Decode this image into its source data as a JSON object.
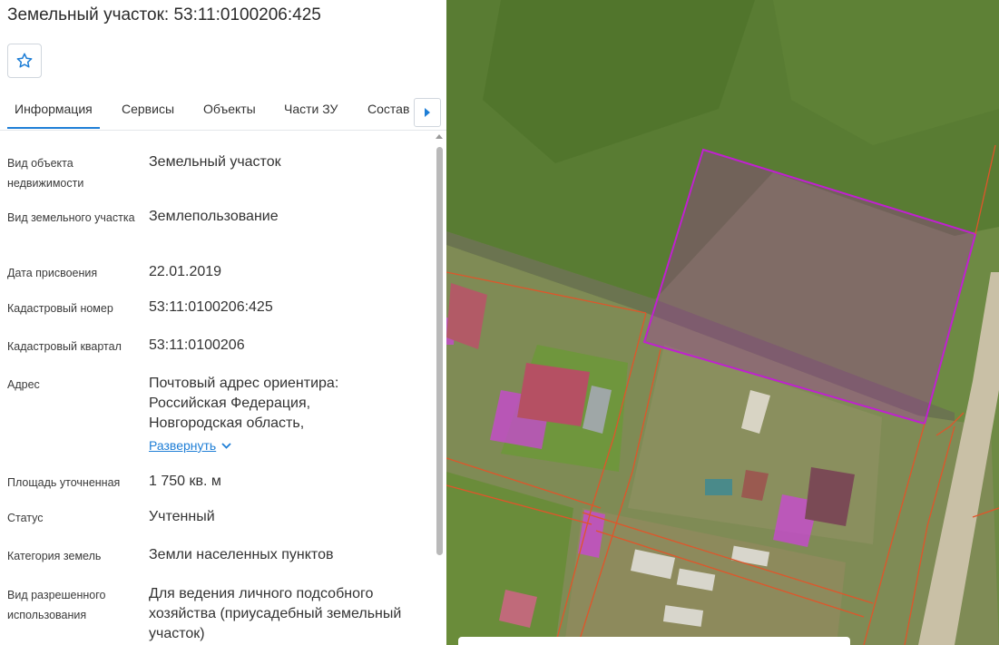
{
  "header": {
    "title": "Земельный участок: 53:11:0100206:425"
  },
  "icons": {
    "favorite": "star-outline-icon",
    "tabs_next": "triangle-right-icon",
    "expand": "chevron-down-icon"
  },
  "tabs": [
    {
      "label": "Информация",
      "active": true
    },
    {
      "label": "Сервисы"
    },
    {
      "label": "Объекты"
    },
    {
      "label": "Части ЗУ"
    },
    {
      "label": "Состав"
    }
  ],
  "details": {
    "object_type": {
      "label": "Вид объекта недвижимости",
      "value": "Земельный участок"
    },
    "plot_type": {
      "label": "Вид земельного участка",
      "value": "Землепользование"
    },
    "date": {
      "label": "Дата присвоения",
      "value": "22.01.2019"
    },
    "cadastral_number": {
      "label": "Кадастровый номер",
      "value": "53:11:0100206:425"
    },
    "cadastral_block": {
      "label": "Кадастровый квартал",
      "value": "53:11:0100206"
    },
    "address": {
      "label": "Адрес",
      "value": "Почтовый адрес ориентира: Российская Федерация, Новгородская область,",
      "expand_label": "Развернуть"
    },
    "area": {
      "label": "Площадь уточненная",
      "value": "1 750 кв. м"
    },
    "status": {
      "label": "Статус",
      "value": "Учтенный"
    },
    "land_category": {
      "label": "Категория земель",
      "value": "Земли населенных пунктов"
    },
    "permitted_use": {
      "label": "Вид разрешенного использования",
      "value": "Для ведения личного подсобного хозяйства (приусадебный земельный участок)"
    }
  },
  "colors": {
    "accent": "#1e7ed6",
    "parcel_highlight": "#b020c0",
    "parcel_border_orange": "#e0552a"
  }
}
